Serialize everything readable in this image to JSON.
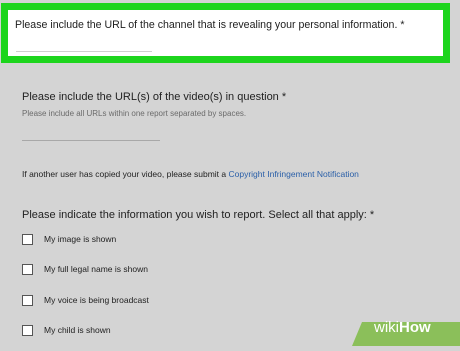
{
  "form": {
    "q1": {
      "label": "Please include the URL of the channel that is revealing your personal information. *"
    },
    "q2": {
      "label": "Please include the URL(s) of the video(s) in question *",
      "help": "Please include all URLs within one report separated by spaces."
    },
    "notice": {
      "text": "If another user has copied your video, please submit a",
      "link": "Copyright Infringement Notification"
    },
    "q3": {
      "label": "Please indicate the information you wish to report. Select all that apply: *",
      "options": [
        {
          "label": "My image is shown",
          "checked": false
        },
        {
          "label": "My full legal name is shown",
          "checked": false
        },
        {
          "label": "My voice is being broadcast",
          "checked": false
        },
        {
          "label": "My child is shown",
          "checked": false
        }
      ]
    }
  },
  "watermark": {
    "part1": "wiki",
    "part2": "How"
  },
  "colors": {
    "highlight": "#1dd51d",
    "background": "#d4d4d4",
    "link": "#2a5fa8",
    "watermark": "#8bbf5a"
  }
}
